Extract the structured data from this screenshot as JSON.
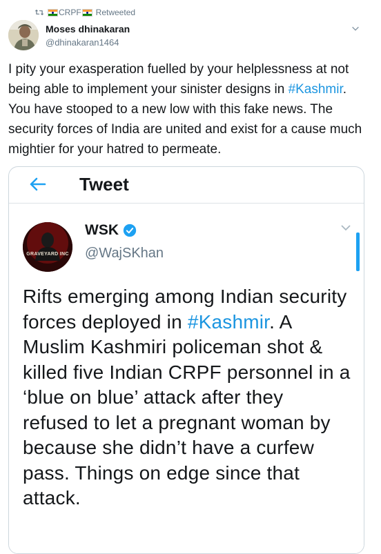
{
  "retweet": {
    "retweeter_name": "CRPF",
    "action_label": "Retweeted"
  },
  "user": {
    "display_name": "Moses dhinakaran",
    "handle": "@dhinakaran1464"
  },
  "tweet": {
    "text_before_hashtag": "I pity your exasperation fuelled by your helplessness at not being able to implement your sinister designs in ",
    "hashtag": "#Kashmir",
    "text_after_hashtag": ". You have stooped to a new low with this fake news. The security forces of India are united and exist for a cause much mightier for your hatred to permeate."
  },
  "embedded_screenshot": {
    "header_title": "Tweet",
    "author_name": "WSK",
    "author_handle": "@WajSKhan",
    "avatar_caption": "GRAVEYARD INC",
    "text_before_hashtag": "Rifts emerging among Indian security forces deployed in ",
    "hashtag": "#Kashmir",
    "text_after_hashtag": ". A Muslim Kashmiri policeman shot & killed five Indian CRPF personnel in a ‘blue on blue’ attack after they refused to let a pregnant woman by because she didn’t have a curfew pass. Things on edge since that attack."
  },
  "colors": {
    "link": "#1b95e0",
    "accent": "#1da1f2",
    "secondary_text": "#657786"
  }
}
